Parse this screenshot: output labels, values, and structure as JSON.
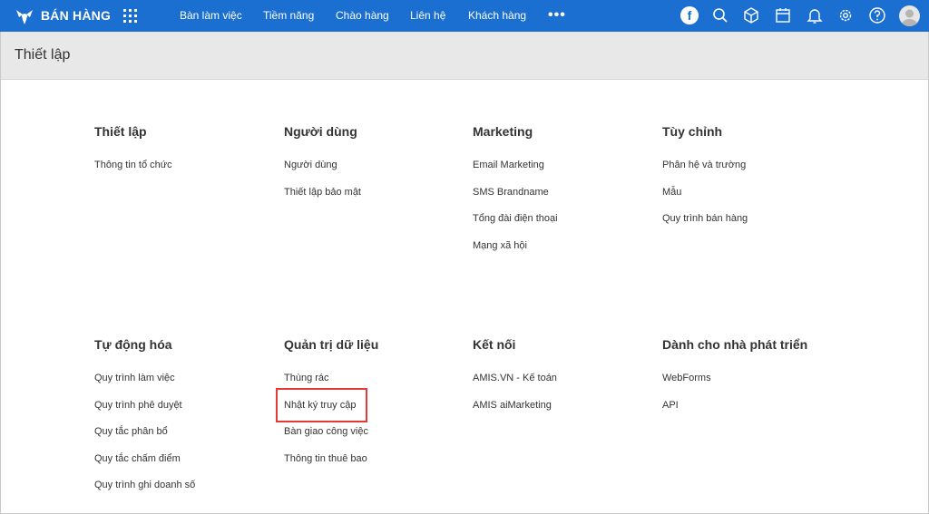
{
  "topbar": {
    "brand": "BÁN HÀNG",
    "nav": [
      "Bàn làm việc",
      "Tiềm năng",
      "Chào hàng",
      "Liên hệ",
      "Khách hàng"
    ],
    "more": "•••",
    "facebook": "f",
    "icons": [
      "search-icon",
      "cube-icon",
      "calendar-icon",
      "bell-icon",
      "gear-icon",
      "help-icon",
      "avatar"
    ],
    "color": "#1a6fd1"
  },
  "page": {
    "title": "Thiết lập"
  },
  "sections": [
    {
      "title": "Thiết lập",
      "items": [
        "Thông tin tổ chức"
      ]
    },
    {
      "title": "Người dùng",
      "items": [
        "Người dùng",
        "Thiết lập bảo mật"
      ]
    },
    {
      "title": "Marketing",
      "items": [
        "Email Marketing",
        "SMS Brandname",
        "Tổng đài điện thoại",
        "Mạng xã hội"
      ]
    },
    {
      "title": "Tùy chỉnh",
      "items": [
        "Phân hệ và trường",
        "Mẫu",
        "Quy trình bán hàng"
      ]
    },
    {
      "title": "Tự động hóa",
      "items": [
        "Quy trình làm việc",
        "Quy trình phê duyệt",
        "Quy tắc phân bổ",
        "Quy tắc chấm điểm",
        "Quy trình ghi doanh số"
      ]
    },
    {
      "title": "Quản trị dữ liệu",
      "items": [
        "Thùng rác",
        "Nhật ký truy cập",
        "Bàn giao công việc",
        "Thông tin thuê bao"
      ]
    },
    {
      "title": "Kết nối",
      "items": [
        "AMIS.VN - Kế toán",
        "AMIS aiMarketing"
      ]
    },
    {
      "title": "Dành cho nhà phát triển",
      "items": [
        "WebForms",
        "API"
      ]
    }
  ],
  "highlight": {
    "section": 5,
    "item": 1,
    "color": "#e53935"
  }
}
